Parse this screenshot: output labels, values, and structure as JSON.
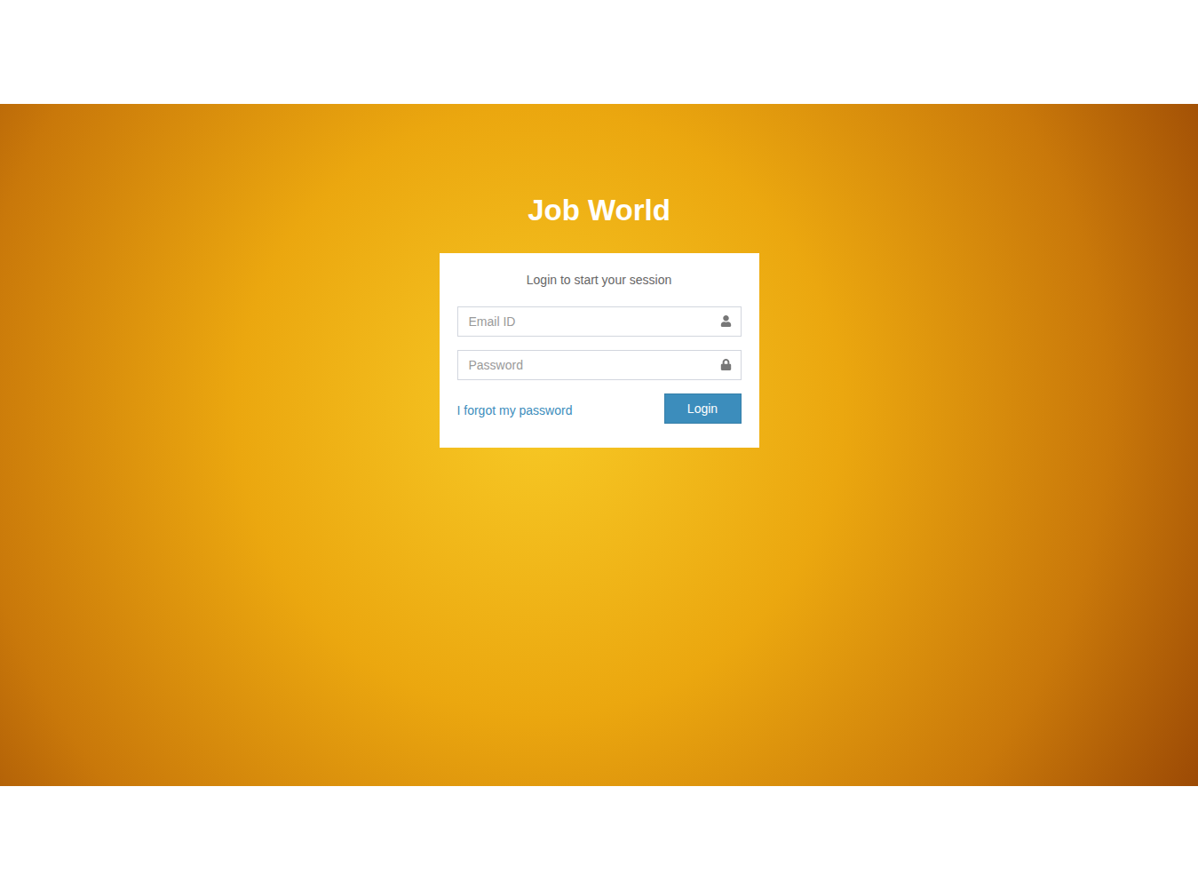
{
  "app": {
    "title": "Job World"
  },
  "login_box": {
    "message": "Login to start your session",
    "fields": [
      {
        "kind": "email",
        "placeholder": "Email ID",
        "value": ""
      },
      {
        "kind": "password",
        "placeholder": "Password",
        "value": ""
      }
    ],
    "forgot_link": "I forgot my password",
    "submit_button": "Login"
  }
}
